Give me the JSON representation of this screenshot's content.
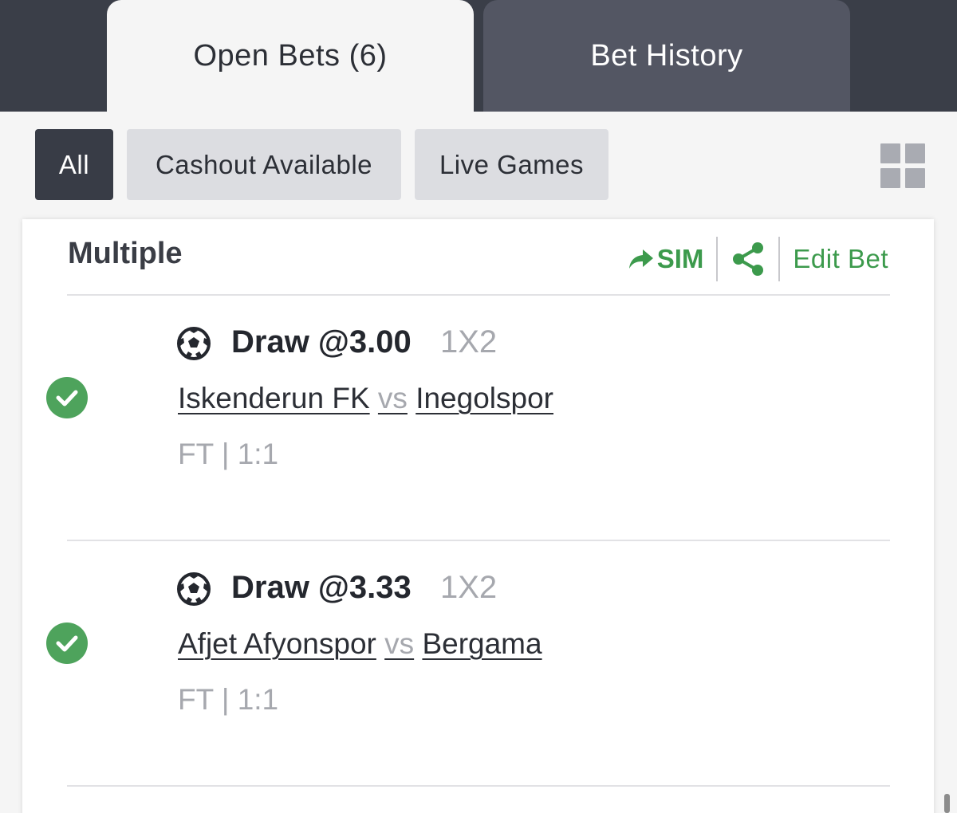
{
  "tabs": {
    "open_bets": "Open Bets (6)",
    "bet_history": "Bet History"
  },
  "filters": {
    "all": "All",
    "cashout": "Cashout Available",
    "live": "Live Games",
    "grid_icon": "grid-view-icon"
  },
  "card": {
    "title": "Multiple",
    "sim_label": "SIM",
    "edit_label": "Edit Bet",
    "accent_color": "#3c9a4c",
    "legs": [
      {
        "pick": "Draw @3.00",
        "market": "1X2",
        "home": "Iskenderun FK",
        "vs": "vs",
        "away": "Inegolspor",
        "result": "FT | 1:1",
        "status": "won",
        "icon": "soccer-ball-icon"
      },
      {
        "pick": "Draw @3.33",
        "market": "1X2",
        "home": "Afjet Afyonspor",
        "vs": "vs",
        "away": "Bergama",
        "result": "FT | 1:1",
        "status": "won",
        "icon": "soccer-ball-icon"
      }
    ]
  }
}
